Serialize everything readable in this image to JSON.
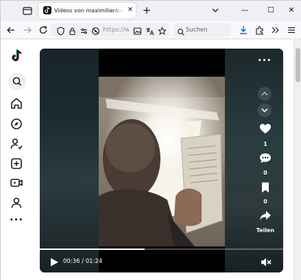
{
  "browser": {
    "tab_title": "Videos von maximilianbaehring",
    "tab_close": "✕",
    "new_tab": "+",
    "url": "https://w",
    "search_placeholder": "Suchen",
    "window_controls": {
      "minimize": "—",
      "maximize": "☐",
      "close": "✕"
    }
  },
  "video": {
    "like_count": "1",
    "comment_count": "0",
    "save_count": "0",
    "share_label": "Teilen",
    "more_label": "•••",
    "current_time": "00:36",
    "duration": "01:24",
    "time_display": "00:36 / 01:24",
    "progress_fraction": 0.43
  },
  "sidebar": {
    "more_label": "•••"
  },
  "colors": {
    "accent_blue": "#0061e0",
    "player_bg": "#000000",
    "page_bg": "#ffffff"
  }
}
